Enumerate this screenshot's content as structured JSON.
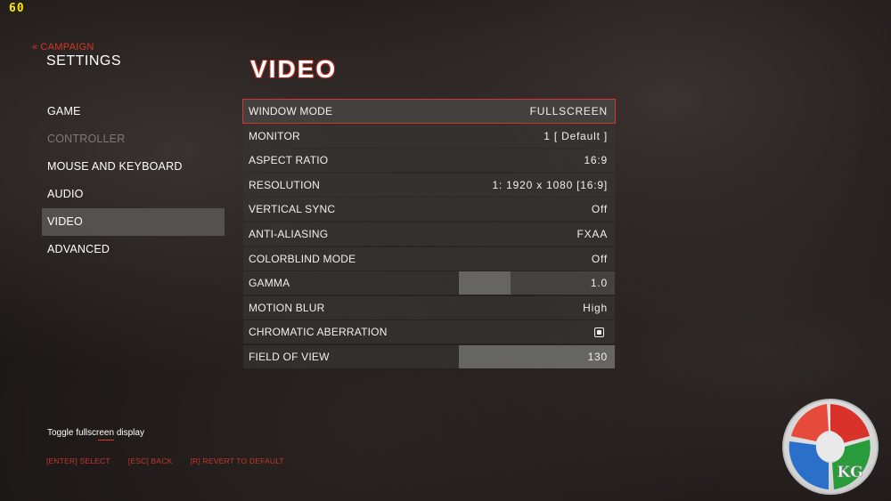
{
  "fps": "60",
  "header": {
    "back_label": "CAMPAIGN",
    "settings_title": "SETTINGS"
  },
  "nav": {
    "items": [
      {
        "label": "GAME",
        "state": "normal"
      },
      {
        "label": "CONTROLLER",
        "state": "disabled"
      },
      {
        "label": "MOUSE AND KEYBOARD",
        "state": "normal"
      },
      {
        "label": "AUDIO",
        "state": "normal"
      },
      {
        "label": "VIDEO",
        "state": "active"
      },
      {
        "label": "ADVANCED",
        "state": "normal"
      }
    ]
  },
  "page": {
    "title": "VIDEO"
  },
  "settings": {
    "window_mode": {
      "label": "WINDOW MODE",
      "value": "FULLSCREEN"
    },
    "monitor": {
      "label": "MONITOR",
      "value": "1 [ Default ]"
    },
    "aspect_ratio": {
      "label": "ASPECT RATIO",
      "value": "16:9"
    },
    "resolution": {
      "label": "RESOLUTION",
      "value": "1: 1920 x 1080 [16:9]"
    },
    "vertical_sync": {
      "label": "VERTICAL SYNC",
      "value": "Off"
    },
    "anti_aliasing": {
      "label": "ANTI-ALIASING",
      "value": "FXAA"
    },
    "colorblind_mode": {
      "label": "COLORBLIND MODE",
      "value": "Off"
    },
    "gamma": {
      "label": "GAMMA",
      "value": "1.0",
      "slider_fraction": 0.33
    },
    "motion_blur": {
      "label": "MOTION BLUR",
      "value": "High"
    },
    "chromatic_aberration": {
      "label": "CHROMATIC ABERRATION",
      "checked": true
    },
    "field_of_view": {
      "label": "FIELD OF VIEW",
      "value": "130",
      "slider_fraction": 1.0
    }
  },
  "hint": "Toggle fullscreen display",
  "footer": {
    "select": "[ENTER] SELECT",
    "back": "[ESC] BACK",
    "revert": "[R] REVERT TO DEFAULT"
  },
  "logo_text": "KG",
  "colors": {
    "accent_red": "#d6362b",
    "fps_yellow": "#ffe800",
    "panel_gray": "#373534"
  }
}
